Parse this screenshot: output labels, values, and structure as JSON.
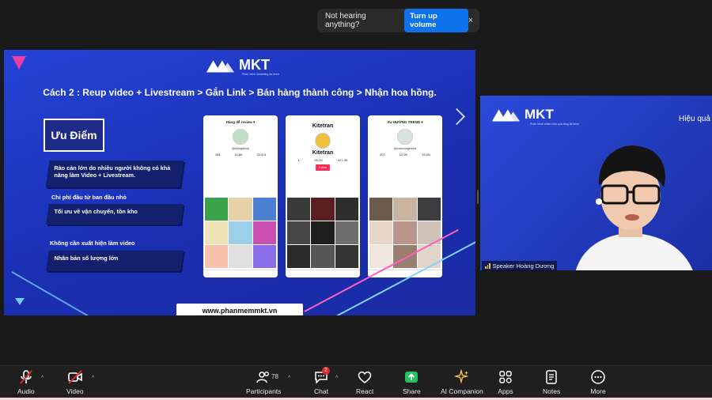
{
  "notification": {
    "text": "Not hearing anything?",
    "button": "Turn up volume",
    "close": "×"
  },
  "slide": {
    "logo": "MKT",
    "logo_subtitle": "Phần mềm marketing đa kênh",
    "title": "Cách 2 : Reup video + Livestream > Gắn Link > Bán hàng thành công > Nhận hoa hồng.",
    "advantages_heading": "Ưu Điểm",
    "points": [
      "Rào cản lớn do nhiều người không có khả năng làm Video + Livestream.",
      "Chi phí đầu từ ban đầu nhỏ",
      "Tối ưu về vận chuyển, tồn kho",
      "Không  cần xuất hiện làm video",
      "Nhân bản số lượng lớn"
    ],
    "url": "www.phanmemmkt.vn",
    "phones": [
      {
        "title": "Hàng dễ review ▾",
        "handle": "@hangdepp",
        "stats": [
          "184",
          "10,8K",
          "33,5 N"
        ]
      },
      {
        "title": "Kitetran",
        "handle": "@kitetran",
        "stats": [
          "1",
          "50,2K",
          "421,3K"
        ],
        "big_name": "Kitetran",
        "follow": "Follow"
      },
      {
        "title": "XU HƯỚNG TREND ▾",
        "handle": "@xuhuongtrend",
        "stats": [
          "207",
          "12,9K",
          "33,0N"
        ]
      }
    ]
  },
  "video_tile": {
    "logo": "MKT",
    "logo_subtitle": "Phần mềm chăm hiệu quả tăng đa kênh",
    "side_text": "Hiệu quả",
    "speaker_label": "Speaker Hoàng Dương"
  },
  "toolbar": {
    "audio": "Audio",
    "video": "Video",
    "participants": "Participants",
    "participants_count": "78",
    "chat": "Chat",
    "chat_badge": "2",
    "react": "React",
    "share": "Share",
    "ai_companion": "AI Companion",
    "apps": "Apps",
    "notes": "Notes",
    "more": "More"
  },
  "colors": {
    "slide_blue": "#1f3cc8",
    "share_green": "#23c45e",
    "alert_red": "#e02828",
    "button_blue": "#0e72ed"
  }
}
